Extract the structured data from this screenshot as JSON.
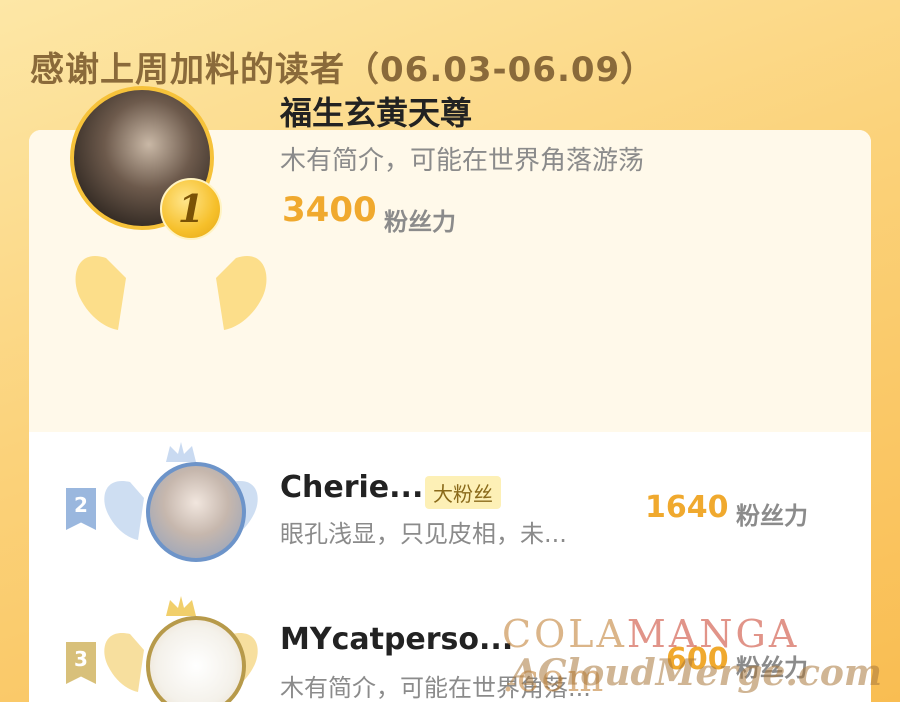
{
  "header": {
    "title": "感谢上周加料的读者（06.03-06.09）"
  },
  "ranking": {
    "first": {
      "rank": "1",
      "name": "福生玄黄天尊",
      "bio": "木有简介，可能在世界角落游荡",
      "score": "3400",
      "score_unit": "粉丝力"
    },
    "others": [
      {
        "rank": "2",
        "name": "Cherie...",
        "badge": "大粉丝",
        "bio": "眼孔浅显，只见皮相，未...",
        "score": "1640",
        "score_unit": "粉丝力"
      },
      {
        "rank": "3",
        "name": "MYcatperso...",
        "bio": "木有简介，可能在世界角落...",
        "score": "600",
        "score_unit": "粉丝力"
      }
    ]
  },
  "watermark": {
    "line1_a": "COLA",
    "line1_b": "MANGA",
    "line1_c": " .com",
    "line2": "ACloudMerge.com"
  },
  "colors": {
    "background_top": "#fde7a6",
    "background_bottom": "#f9bd52",
    "accent_gold": "#f6c23a",
    "score_orange": "#f0a92e",
    "rank2_blue": "#6d94c9",
    "rank3_bronze": "#b79a4a"
  },
  "icons": {
    "crown": "crown-icon",
    "wings": "wings-icon",
    "rank_medal": "rank-medal-icon",
    "rank_ribbon": "rank-ribbon-icon"
  }
}
